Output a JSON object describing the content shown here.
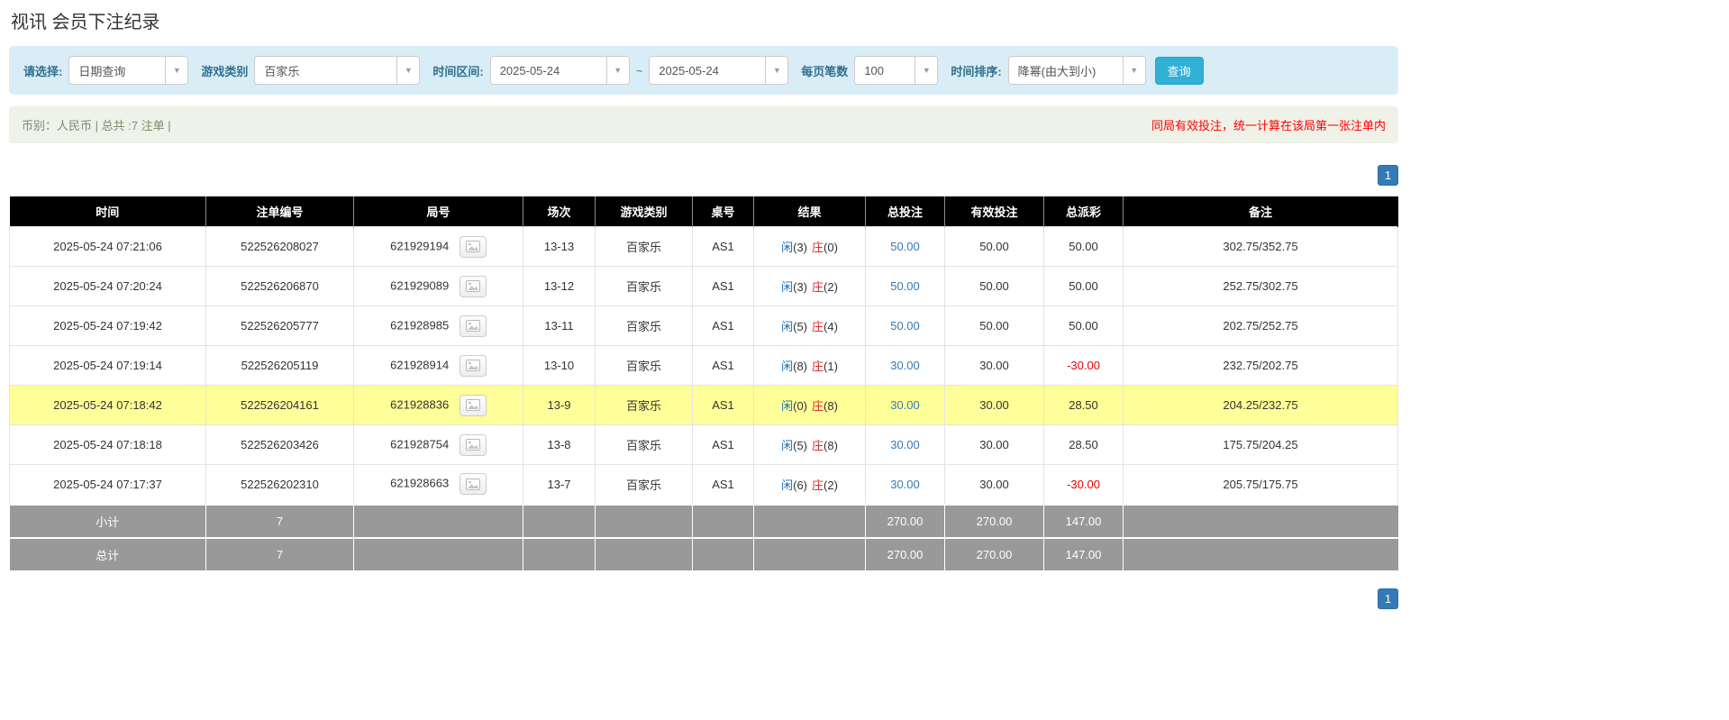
{
  "page": {
    "title": "视讯 会员下注纪录"
  },
  "colors": {
    "filter_bar_bg": "#d9edf7",
    "search_button_blue": "#31b0d5",
    "pagination_blue": "#337ab7",
    "highlight_row_yellow": "#ffff99",
    "player_blue": "#1b6cb5",
    "banker_red": "#e22a2a",
    "negative_red": "#e60000",
    "notice_red": "#ff0000",
    "summary_row_gray": "#999999",
    "header_black": "#000000"
  },
  "filters": {
    "select_label": "请选择:",
    "query_type_value": "日期查询",
    "game_category_label": "游戏类别",
    "game_category_value": "百家乐",
    "time_range_label": "时间区间:",
    "date_from": "2025-05-24",
    "range_separator": "~",
    "date_to": "2025-05-24",
    "page_size_label": "每页笔数",
    "page_size_value": "100",
    "sort_label": "时间排序:",
    "sort_value": "降幂(由大到小)",
    "search_button_label": "查询"
  },
  "info_bar": {
    "summary": "币别：人民币 | 总共 :7 注单 |",
    "notice": "同局有效投注，统一计算在该局第一张注单内"
  },
  "pagination": {
    "current_page": "1"
  },
  "table": {
    "headers": [
      "时间",
      "注单编号",
      "局号",
      "场次",
      "游戏类别",
      "桌号",
      "结果",
      "总投注",
      "有效投注",
      "总派彩",
      "备注"
    ],
    "rows": [
      {
        "time": "2025-05-24 07:21:06",
        "bet_id": "522526208027",
        "round": "621929194",
        "session": "13-13",
        "game": "百家乐",
        "table": "AS1",
        "player": "闲",
        "player_n": "(3)",
        "banker": "庄",
        "banker_n": "(0)",
        "total_bet": "50.00",
        "valid_bet": "50.00",
        "payout": "50.00",
        "note": "302.75/352.75",
        "highlight": false
      },
      {
        "time": "2025-05-24 07:20:24",
        "bet_id": "522526206870",
        "round": "621929089",
        "session": "13-12",
        "game": "百家乐",
        "table": "AS1",
        "player": "闲",
        "player_n": "(3)",
        "banker": "庄",
        "banker_n": "(2)",
        "total_bet": "50.00",
        "valid_bet": "50.00",
        "payout": "50.00",
        "note": "252.75/302.75",
        "highlight": false
      },
      {
        "time": "2025-05-24 07:19:42",
        "bet_id": "522526205777",
        "round": "621928985",
        "session": "13-11",
        "game": "百家乐",
        "table": "AS1",
        "player": "闲",
        "player_n": "(5)",
        "banker": "庄",
        "banker_n": "(4)",
        "total_bet": "50.00",
        "valid_bet": "50.00",
        "payout": "50.00",
        "note": "202.75/252.75",
        "highlight": false
      },
      {
        "time": "2025-05-24 07:19:14",
        "bet_id": "522526205119",
        "round": "621928914",
        "session": "13-10",
        "game": "百家乐",
        "table": "AS1",
        "player": "闲",
        "player_n": "(8)",
        "banker": "庄",
        "banker_n": "(1)",
        "total_bet": "30.00",
        "valid_bet": "30.00",
        "payout": "-30.00",
        "note": "232.75/202.75",
        "highlight": false
      },
      {
        "time": "2025-05-24 07:18:42",
        "bet_id": "522526204161",
        "round": "621928836",
        "session": "13-9",
        "game": "百家乐",
        "table": "AS1",
        "player": "闲",
        "player_n": "(0)",
        "banker": "庄",
        "banker_n": "(8)",
        "total_bet": "30.00",
        "valid_bet": "30.00",
        "payout": "28.50",
        "note": "204.25/232.75",
        "highlight": true
      },
      {
        "time": "2025-05-24 07:18:18",
        "bet_id": "522526203426",
        "round": "621928754",
        "session": "13-8",
        "game": "百家乐",
        "table": "AS1",
        "player": "闲",
        "player_n": "(5)",
        "banker": "庄",
        "banker_n": "(8)",
        "total_bet": "30.00",
        "valid_bet": "30.00",
        "payout": "28.50",
        "note": "175.75/204.25",
        "highlight": false
      },
      {
        "time": "2025-05-24 07:17:37",
        "bet_id": "522526202310",
        "round": "621928663",
        "session": "13-7",
        "game": "百家乐",
        "table": "AS1",
        "player": "闲",
        "player_n": "(6)",
        "banker": "庄",
        "banker_n": "(2)",
        "total_bet": "30.00",
        "valid_bet": "30.00",
        "payout": "-30.00",
        "note": "205.75/175.75",
        "highlight": false
      }
    ],
    "subtotal": {
      "label": "小计",
      "count": "7",
      "total_bet": "270.00",
      "valid_bet": "270.00",
      "payout": "147.00"
    },
    "total": {
      "label": "总计",
      "count": "7",
      "total_bet": "270.00",
      "valid_bet": "270.00",
      "payout": "147.00"
    }
  }
}
